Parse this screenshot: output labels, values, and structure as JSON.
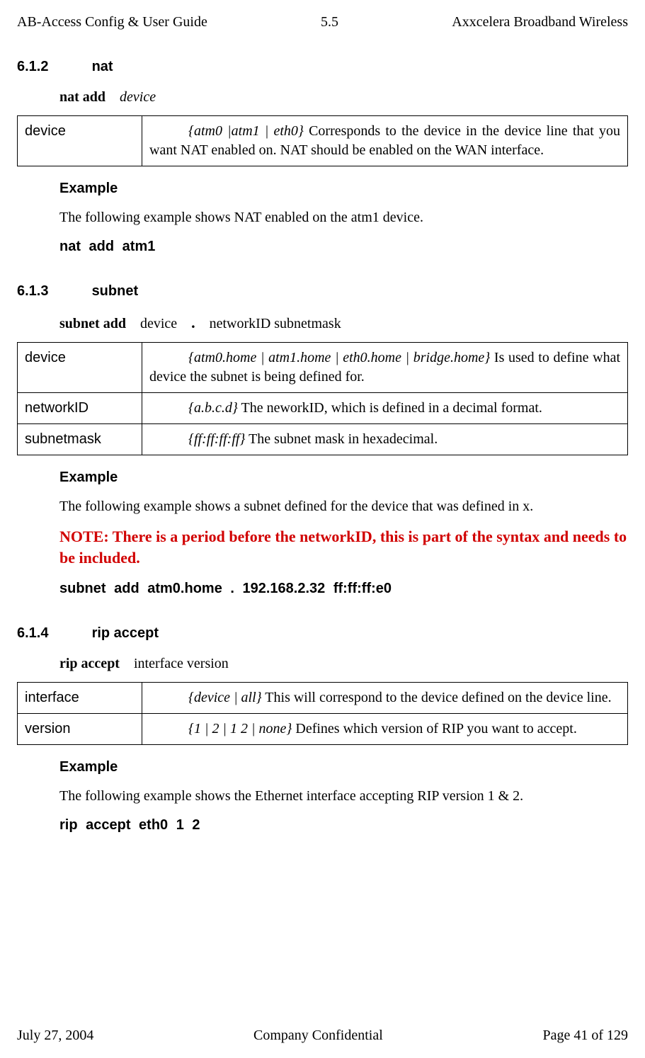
{
  "header": {
    "left": "AB-Access Config & User Guide",
    "center": "5.5",
    "right": "Axxcelera Broadband Wireless"
  },
  "footer": {
    "left": "July 27, 2004",
    "center": "Company Confidential",
    "right": "Page 41 of 129"
  },
  "sections": {
    "nat": {
      "num": "6.1.2",
      "title": "nat",
      "syntax_kw": "nat   add",
      "syntax_arg": "device",
      "params": {
        "device_name": "device",
        "device_opt": "{atm0 |atm1 | eth0}",
        "device_desc": " Corresponds to the device in the device line that you want NAT enabled on. NAT should be enabled on the WAN interface."
      },
      "example_label": "Example",
      "example_text": "The following example shows NAT enabled on the atm1 device.",
      "example_cmd": "nat   add   atm1"
    },
    "subnet": {
      "num": "6.1.3",
      "title": "subnet",
      "syntax_kw": "subnet   add",
      "syntax_arg1": "device",
      "syntax_dot": ".",
      "syntax_arg2": "networkID   subnetmask",
      "params": {
        "device_name": "device",
        "device_opt": "{atm0.home | atm1.home | eth0.home | bridge.home}",
        "device_desc": " Is used to define what device the subnet is being defined for.",
        "networkID_name": "networkID",
        "networkID_opt": "{a.b.c.d}",
        "networkID_desc": " The neworkID, which is defined in a decimal format.",
        "subnetmask_name": "subnetmask",
        "subnetmask_opt": "{ff:ff:ff:ff}",
        "subnetmask_desc": " The subnet mask in hexadecimal."
      },
      "example_label": "Example",
      "example_text": "The following example shows a subnet defined for the device that was defined in x.",
      "note": "NOTE: There is a period before the networkID, this is part of the syntax and needs to be included.",
      "example_cmd": "subnet   add   atm0.home   .   192.168.2.32   ff:ff:ff:e0"
    },
    "rip": {
      "num": "6.1.4",
      "title": "rip accept",
      "syntax_kw": "rip   accept",
      "syntax_arg": "interface   version",
      "params": {
        "interface_name": "interface",
        "interface_opt": "{device | all}",
        "interface_desc": " This will correspond to the device defined on the device line.",
        "version_name": "version",
        "version_opt": "{1 | 2 | 1 2 | none}",
        "version_desc": " Defines which version of RIP you want to accept."
      },
      "example_label": "Example",
      "example_text": "The following example shows the Ethernet interface accepting RIP version 1 & 2.",
      "example_cmd": "rip   accept   eth0   1   2"
    }
  }
}
